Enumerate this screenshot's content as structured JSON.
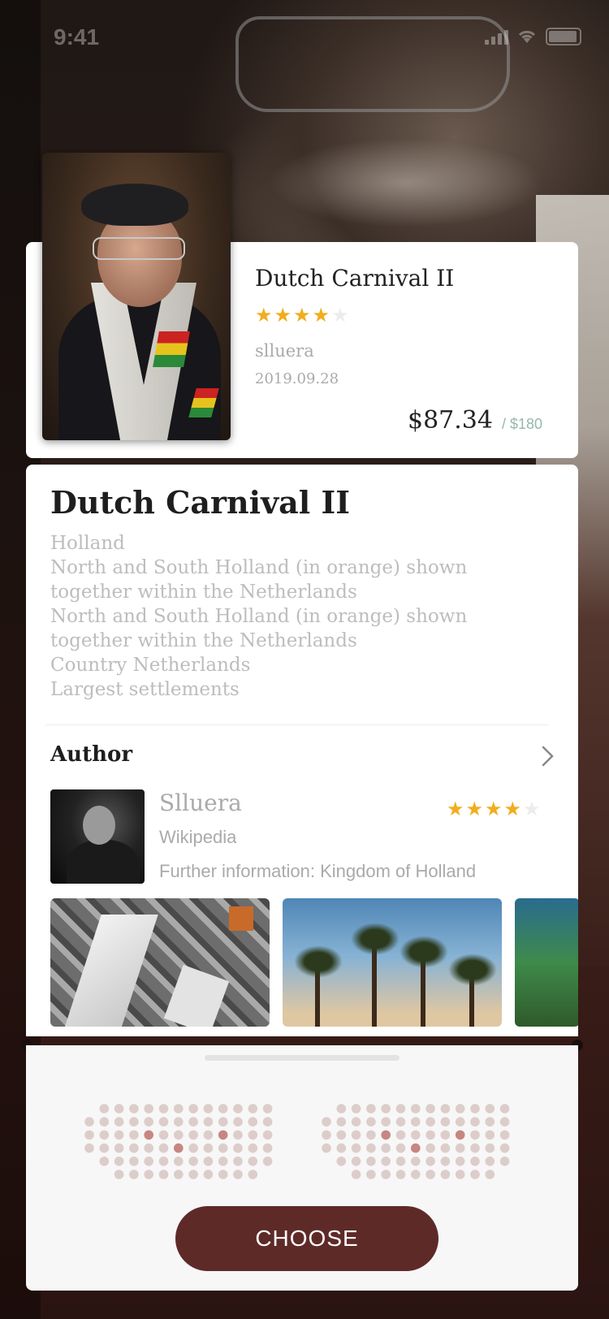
{
  "status_bar": {
    "time": "9:41"
  },
  "card": {
    "title": "Dutch Carnival II",
    "rating": 4,
    "max_rating": 5,
    "user": "slluera",
    "date": "2019.09.28",
    "price": "$87.34",
    "original_price": "/ $180"
  },
  "detail": {
    "title": "Dutch Carnival II",
    "description": [
      "Holland",
      "North and South Holland (in orange) shown",
      "together within the Netherlands",
      "North and South Holland (in orange) shown",
      "together within the Netherlands",
      "Country  Netherlands",
      "Largest settlements"
    ],
    "author_heading": "Author",
    "author": {
      "name": "Slluera",
      "source": "Wikipedia",
      "info": "Further information: Kingdom of Holland",
      "rating": 4,
      "max_rating": 5
    },
    "gallery": [
      "city-photo",
      "palm-trees-photo",
      "ocean-wave-photo"
    ]
  },
  "seat_selector": {
    "colors": {
      "available": "#dccdcb",
      "selected": "#c78682"
    }
  },
  "actions": {
    "choose_label": "CHOOSE"
  },
  "colors": {
    "accent": "#5e2a28",
    "star": "#f1ad1c",
    "price_old": "#95b8aa"
  }
}
